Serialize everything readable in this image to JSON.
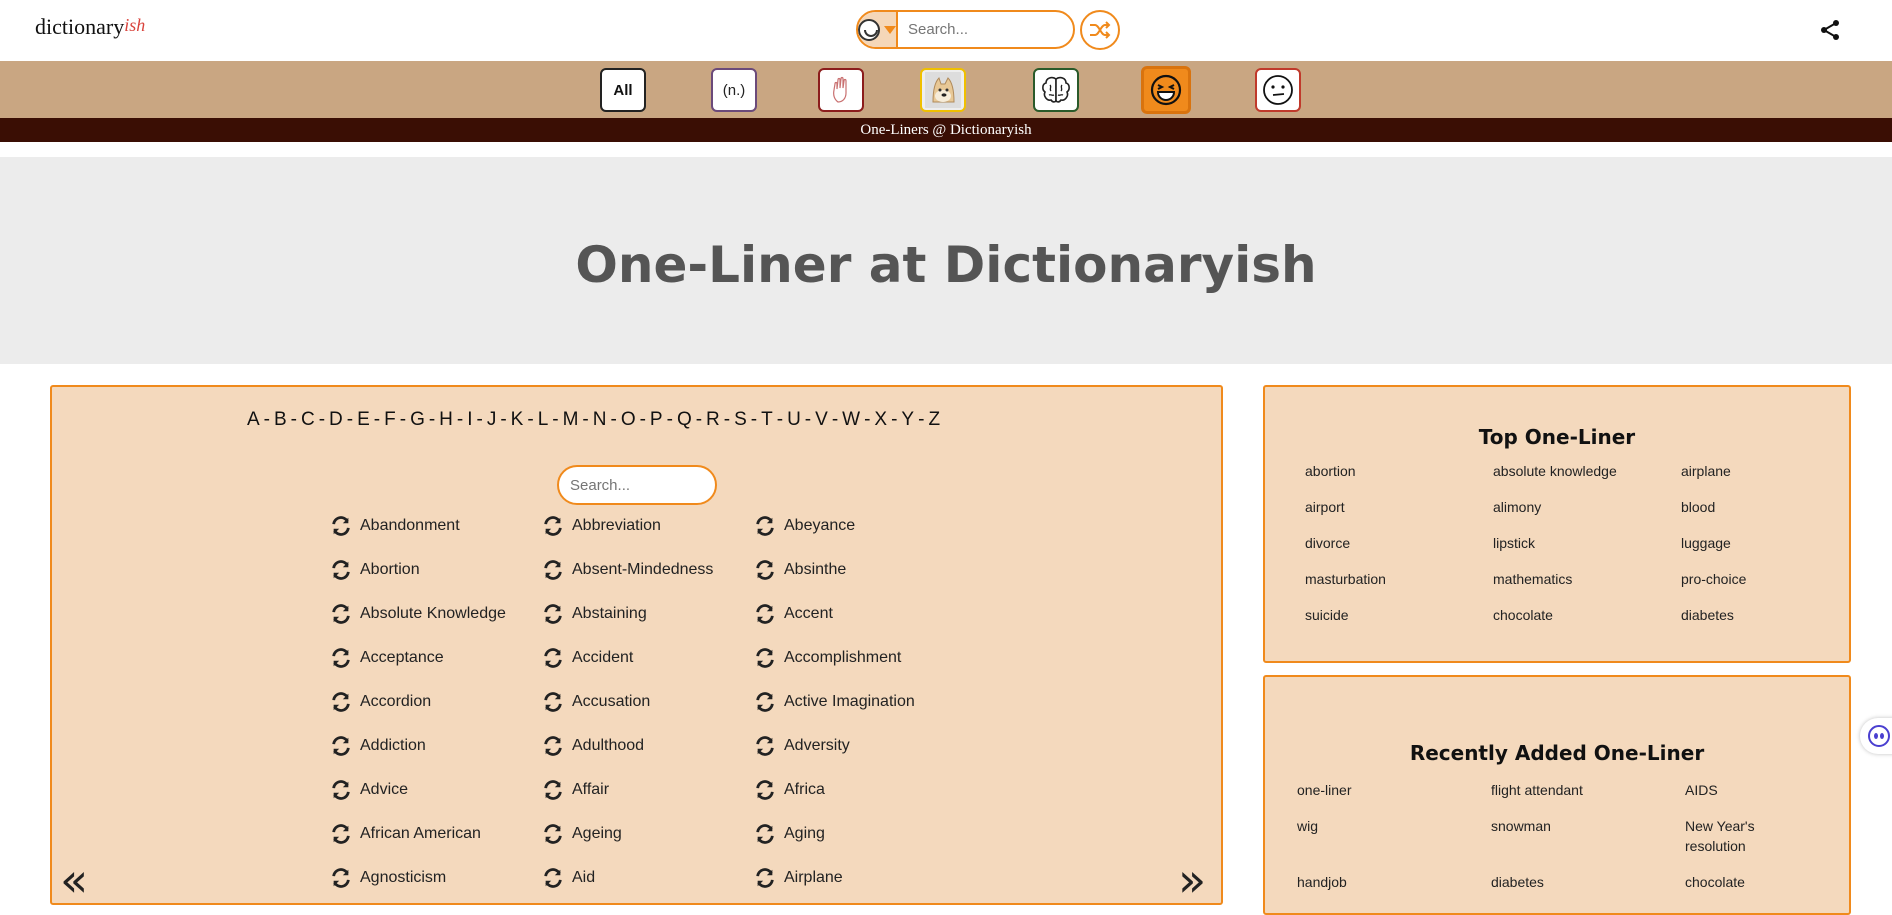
{
  "header": {
    "logo_main": "dictionary",
    "logo_ish": "ish",
    "search_placeholder": "Search...",
    "search_category_icon": "laughing-face-icon",
    "shuffle_icon": "shuffle-icon",
    "share_icon": "share-icon"
  },
  "categories": {
    "all": "All",
    "noun": "(n.)"
  },
  "subbar": {
    "title": "One-Liners @ Dictionaryish"
  },
  "hero": {
    "title": "One-Liner at Dictionaryish"
  },
  "alphabet": [
    "A",
    "B",
    "C",
    "D",
    "E",
    "F",
    "G",
    "H",
    "I",
    "J",
    "K",
    "L",
    "M",
    "N",
    "O",
    "P",
    "Q",
    "R",
    "S",
    "T",
    "U",
    "V",
    "W",
    "X",
    "Y",
    "Z"
  ],
  "panel_search_placeholder": "Search...",
  "words": {
    "col1": [
      "Abandonment",
      "Abortion",
      "Absolute Knowledge",
      "Acceptance",
      "Accordion",
      "Addiction",
      "Advice",
      "African American",
      "Agnosticism"
    ],
    "col2": [
      "Abbreviation",
      "Absent-Mindedness",
      "Abstaining",
      "Accident",
      "Accusation",
      "Adulthood",
      "Affair",
      "Ageing",
      "Aid"
    ],
    "col3": [
      "Abeyance",
      "Absinthe",
      "Accent",
      "Accomplishment",
      "Active Imagination",
      "Adversity",
      "Africa",
      "Aging",
      "Airplane"
    ]
  },
  "pager": {
    "prev": "«",
    "next": "»"
  },
  "top_one_liner": {
    "title": "Top One-Liner",
    "items": [
      "abortion",
      "absolute knowledge",
      "airplane",
      "airport",
      "alimony",
      "blood",
      "divorce",
      "lipstick",
      "luggage",
      "masturbation",
      "mathematics",
      "pro-choice",
      "suicide",
      "chocolate",
      "diabetes"
    ]
  },
  "recent_one_liner": {
    "title": "Recently Added One-Liner",
    "items": [
      "one-liner",
      "flight attendant",
      "AIDS",
      "wig",
      "snowman",
      "New Year's resolution",
      "handjob",
      "diabetes",
      "chocolate"
    ]
  },
  "colors": {
    "accent": "#f08a1c",
    "panel_bg": "#f4d9bd",
    "category_bar": "#c9a682",
    "subbar_bg": "#3a0e04",
    "hero_bg": "#ececec"
  }
}
